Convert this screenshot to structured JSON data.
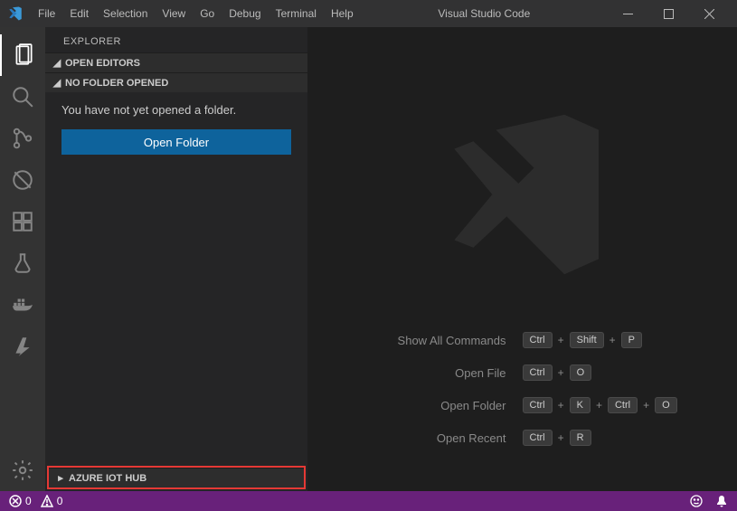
{
  "titlebar": {
    "app_name": "Visual Studio Code",
    "menu": [
      "File",
      "Edit",
      "Selection",
      "View",
      "Go",
      "Debug",
      "Terminal",
      "Help"
    ]
  },
  "sidebar": {
    "title": "EXPLORER",
    "sections": {
      "open_editors": {
        "label": "OPEN EDITORS",
        "expanded": true
      },
      "no_folder": {
        "label": "NO FOLDER OPENED",
        "expanded": true,
        "message": "You have not yet opened a folder.",
        "button": "Open Folder"
      },
      "azure": {
        "label": "AZURE IOT HUB",
        "expanded": false
      }
    }
  },
  "welcome": {
    "shortcuts": [
      {
        "label": "Show All Commands",
        "keys": [
          "Ctrl",
          "Shift",
          "P"
        ]
      },
      {
        "label": "Open File",
        "keys": [
          "Ctrl",
          "O"
        ]
      },
      {
        "label": "Open Folder",
        "keys": [
          "Ctrl",
          "K",
          "Ctrl",
          "O"
        ]
      },
      {
        "label": "Open Recent",
        "keys": [
          "Ctrl",
          "R"
        ]
      }
    ]
  },
  "statusbar": {
    "errors": "0",
    "warnings": "0"
  },
  "colors": {
    "accent": "#0e639c",
    "statusbar": "#68217a",
    "highlight": "#e53935"
  }
}
